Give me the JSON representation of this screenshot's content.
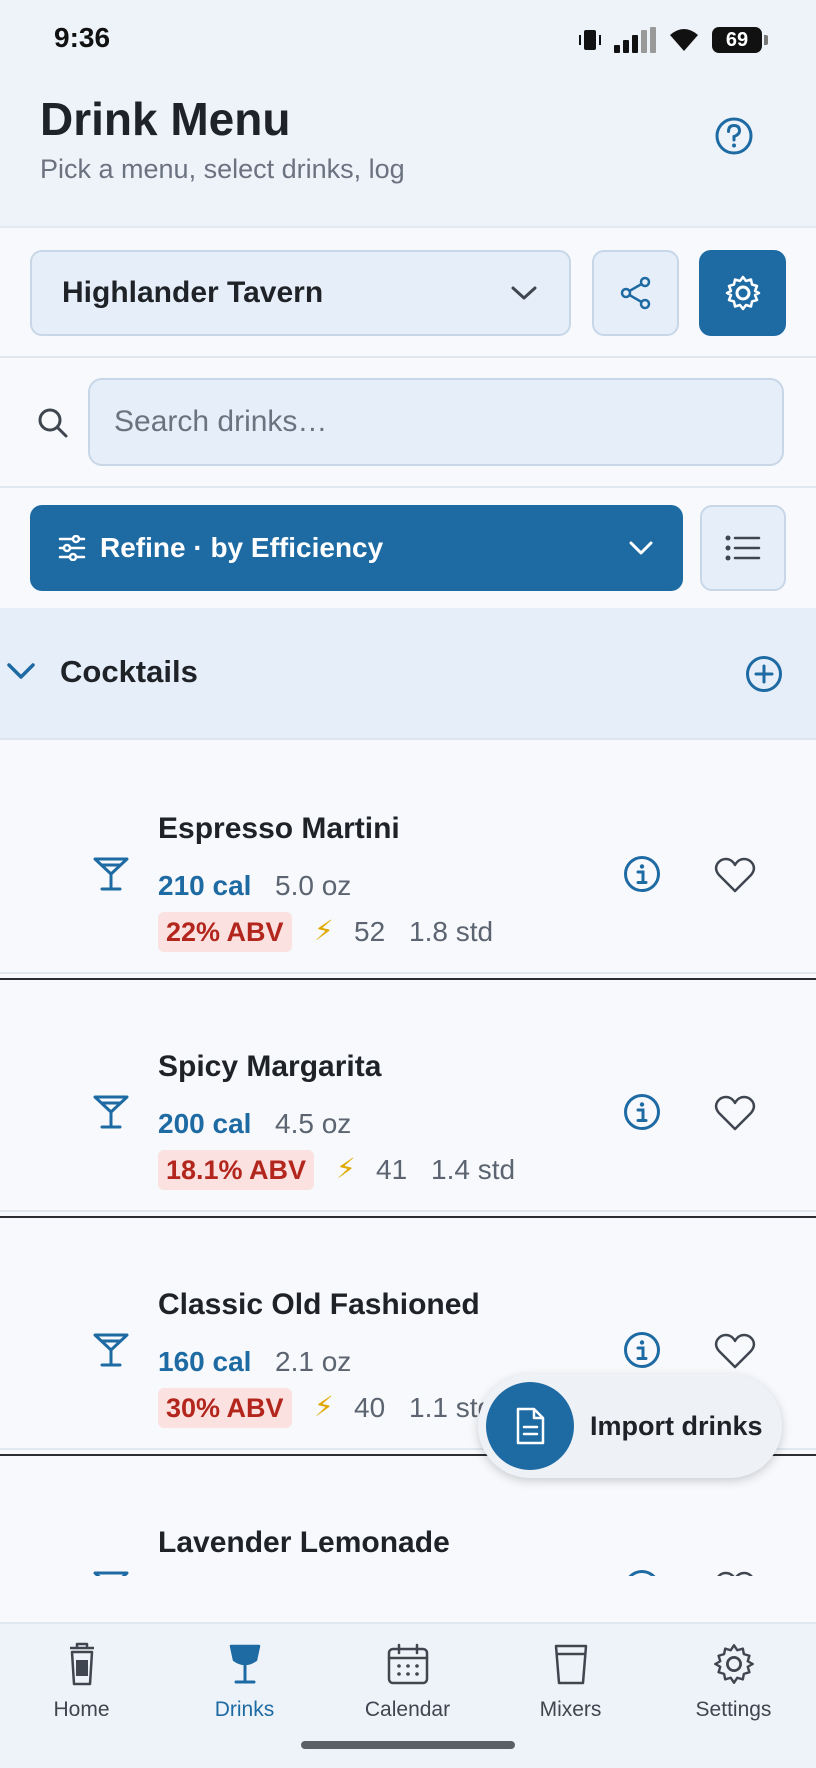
{
  "status_bar": {
    "time": "9:36",
    "battery": "69"
  },
  "header": {
    "title": "Drink Menu",
    "subtitle": "Pick a menu, select drinks, log"
  },
  "menu_selector": {
    "value": "Highlander Tavern"
  },
  "search": {
    "placeholder": "Search drinks…",
    "value": ""
  },
  "refine": {
    "label": "Refine · by Efficiency"
  },
  "section": {
    "title": "Cocktails"
  },
  "drinks": [
    {
      "name": "Espresso Martini",
      "calories": "210 cal",
      "volume": "5.0 oz",
      "abv": "22% ABV",
      "efficiency": "52",
      "std": "1.8 std"
    },
    {
      "name": "Spicy Margarita",
      "calories": "200 cal",
      "volume": "4.5 oz",
      "abv": "18.1% ABV",
      "efficiency": "41",
      "std": "1.4 std"
    },
    {
      "name": "Classic Old Fashioned",
      "calories": "160 cal",
      "volume": "2.1 oz",
      "abv": "30% ABV",
      "efficiency": "40",
      "std": "1.1 std"
    },
    {
      "name": "Lavender Lemonade",
      "calories": "",
      "volume": "",
      "abv": "",
      "efficiency": "",
      "std": ""
    }
  ],
  "fab": {
    "label": "Import drinks"
  },
  "tabbar": {
    "tabs": [
      {
        "label": "Home",
        "icon": "trash-can-icon"
      },
      {
        "label": "Drinks",
        "icon": "cocktail-glass-icon",
        "active": true
      },
      {
        "label": "Calendar",
        "icon": "calendar-icon"
      },
      {
        "label": "Mixers",
        "icon": "cup-icon"
      },
      {
        "label": "Settings",
        "icon": "gear-icon"
      }
    ]
  },
  "colors": {
    "accent": "#1e6aa3",
    "abv_badge_bg": "#fbe1df",
    "abv_badge_text": "#b3261e",
    "bolt": "#e0a800"
  }
}
